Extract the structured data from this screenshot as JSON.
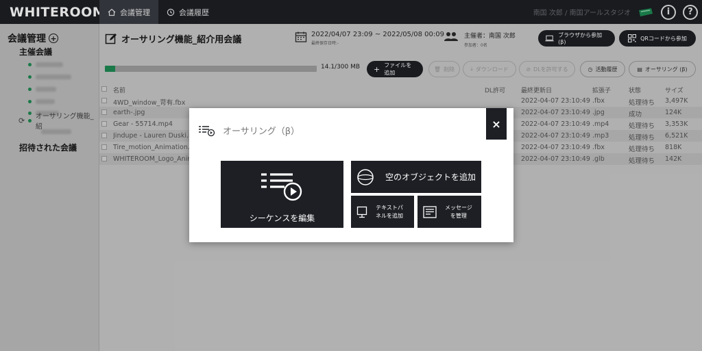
{
  "app": {
    "logo": "WHITEROOM"
  },
  "nav": {
    "tabs": [
      {
        "label": "会議管理",
        "active": true
      },
      {
        "label": "会議履歴",
        "active": false
      }
    ]
  },
  "user": {
    "name": "南国 次郎 / 南国アールスタジオ"
  },
  "sidebar": {
    "title": "会議管理",
    "hosted_label": "主催会議",
    "current_item": "オーサリング機能_紹",
    "invited_label": "招待された会議"
  },
  "meeting": {
    "title": "オーサリング機能_紹介用会議",
    "date_range": "2022/04/07 23:09 ~ 2022/05/08 00:09",
    "last_saved": "最終保存日時:-",
    "host": "主催者：南国 次郎",
    "participants": "参加者：0名"
  },
  "buttons": {
    "join_browser": "ブラウザから参加 (β)",
    "join_qr": "QRコードから参加",
    "add_file": "ファイルを追加",
    "delete": "削除",
    "download": "ダウンロード",
    "allow_dl": "DLを許可する",
    "activity": "活動履歴",
    "authoring": "オーサリング (β)"
  },
  "storage": {
    "used_label": "14.1/300 MB",
    "fraction": 0.047
  },
  "table": {
    "headers": {
      "name": "名前",
      "dl": "DL許可",
      "updated": "最終更新日",
      "ext": "拡張子",
      "status": "状態",
      "size": "サイズ"
    },
    "rows": [
      {
        "name": "4WD_window_苛有.fbx",
        "updated": "2022-04-07 23:10:49",
        "ext": ".fbx",
        "status": "処理待ち",
        "size": "3,497K"
      },
      {
        "name": "earth-.jpg",
        "updated": "2022-04-07 23:10:49",
        "ext": ".jpg",
        "status": "成功",
        "size": "124K"
      },
      {
        "name": "Gear - 55714.mp4",
        "updated": "2022-04-07 23:10:49",
        "ext": ".mp4",
        "status": "処理待ち",
        "size": "3,353K"
      },
      {
        "name": "Jindupe - Lauren Duski.m",
        "updated": "2022-04-07 23:10:49",
        "ext": ".mp3",
        "status": "処理待ち",
        "size": "6,521K"
      },
      {
        "name": "Tire_motion_Animation.fb",
        "updated": "2022-04-07 23:10:49",
        "ext": ".fbx",
        "status": "処理待ち",
        "size": "818K"
      },
      {
        "name": "WHITEROOM_Logo_Anim",
        "updated": "2022-04-07 23:10:49",
        "ext": ".glb",
        "status": "処理待ち",
        "size": "142K"
      }
    ]
  },
  "modal": {
    "title": "オーサリング（β）",
    "close": "×",
    "tile_sequence": "シーケンスを編集",
    "tile_empty_object": "空のオブジェクトを追加",
    "tile_text_panel_1": "テキストパ",
    "tile_text_panel_2": "ネルを追加",
    "tile_message_1": "メッセージ",
    "tile_message_2": "を管理"
  },
  "colors": {
    "dark": "#1d1f24",
    "accent": "#1e8a52"
  },
  "icons": [
    "home-icon",
    "history-icon",
    "info-icon",
    "help-icon",
    "edit-icon",
    "calendar-icon",
    "people-icon",
    "laptop-icon",
    "qr-icon",
    "plus-icon",
    "trash-icon",
    "download-icon",
    "lock-icon",
    "clock-icon",
    "authoring-icon",
    "sequence-icon",
    "sphere-icon",
    "monitor-icon",
    "message-icon",
    "sync-icon"
  ]
}
